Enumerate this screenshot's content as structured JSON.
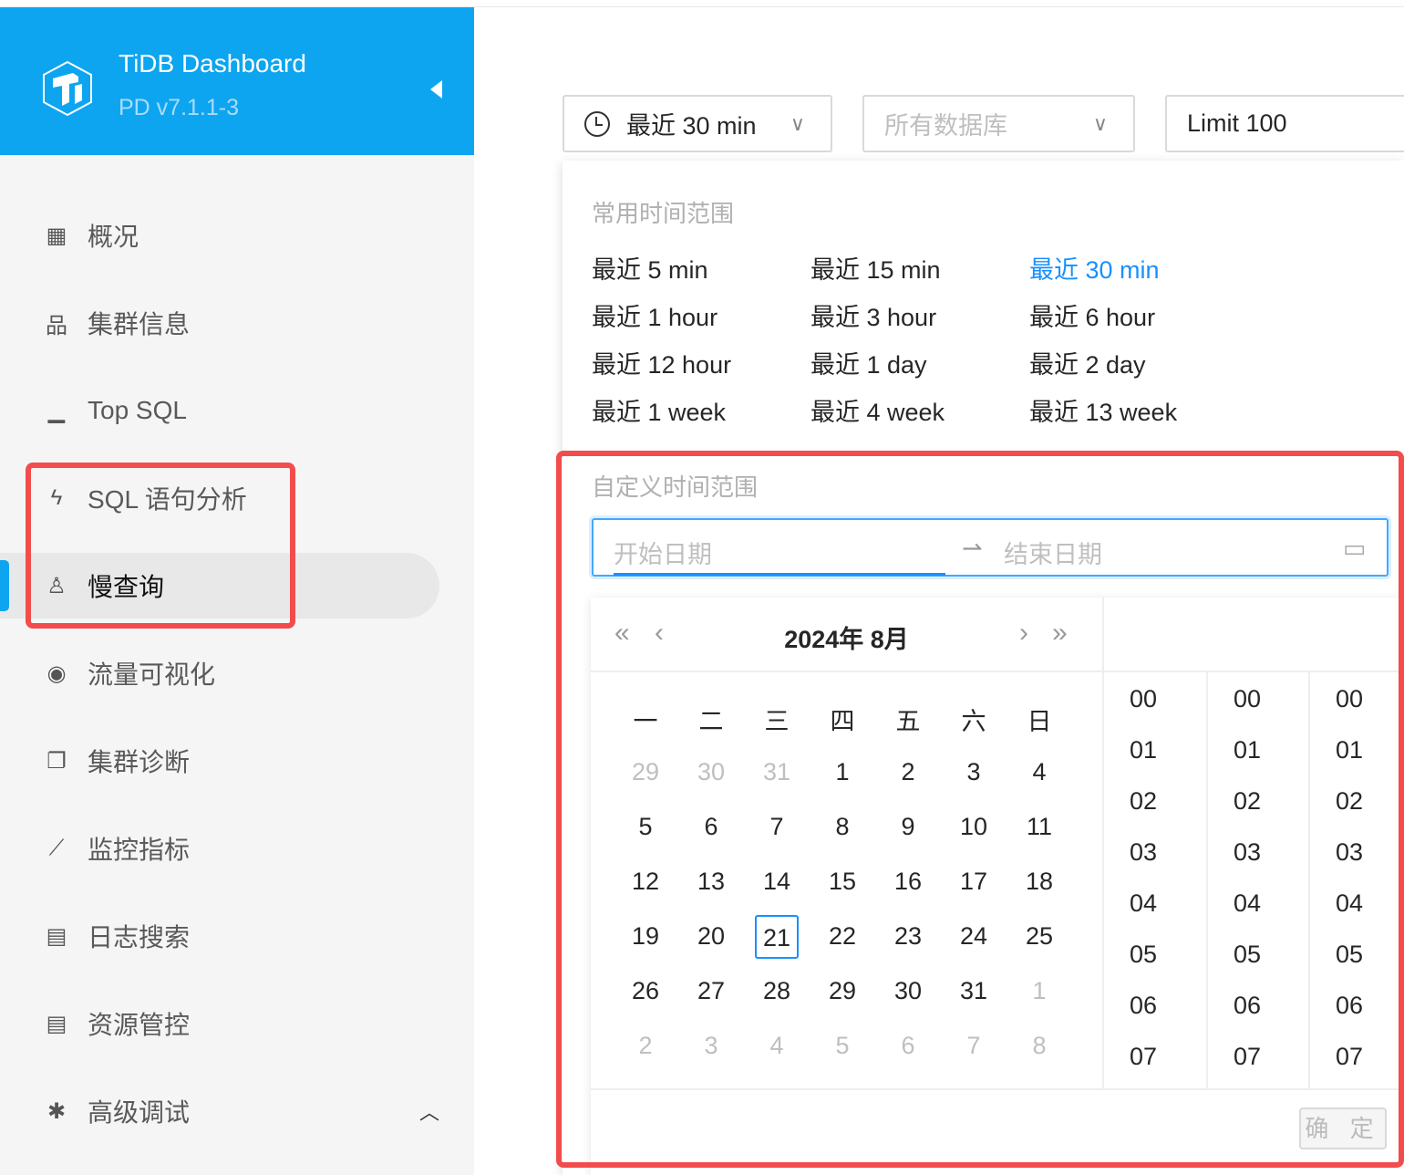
{
  "app": {
    "title": "TiDB Dashboard",
    "version": "PD v7.1.1-3"
  },
  "sidebar": {
    "items": [
      {
        "label": "概况",
        "icon": "dashboard-icon",
        "glyph": "▦"
      },
      {
        "label": "集群信息",
        "icon": "cluster-icon",
        "glyph": "品"
      },
      {
        "label": "Top SQL",
        "icon": "bar-chart-icon",
        "glyph": "▁"
      },
      {
        "label": "SQL 语句分析",
        "icon": "thunderbolt-icon",
        "glyph": "ϟ"
      },
      {
        "label": "慢查询",
        "icon": "alert-icon",
        "glyph": "♙"
      },
      {
        "label": "流量可视化",
        "icon": "eye-icon",
        "glyph": "◉"
      },
      {
        "label": "集群诊断",
        "icon": "diagnose-icon",
        "glyph": "❐"
      },
      {
        "label": "监控指标",
        "icon": "line-chart-icon",
        "glyph": "⟋"
      },
      {
        "label": "日志搜索",
        "icon": "file-search-icon",
        "glyph": "▤"
      },
      {
        "label": "资源管控",
        "icon": "resource-icon",
        "glyph": "▤"
      },
      {
        "label": "高级调试",
        "icon": "bug-icon",
        "glyph": "✱"
      }
    ],
    "selected": 4
  },
  "toolbar": {
    "time_range": "最近 30 min",
    "database_placeholder": "所有数据库",
    "limit": "Limit 100"
  },
  "picker": {
    "common_label": "常用时间范围",
    "presets": [
      "最近 5 min",
      "最近 15 min",
      "最近 30 min",
      "最近 1 hour",
      "最近 3 hour",
      "最近 6 hour",
      "最近 12 hour",
      "最近 1 day",
      "最近 2 day",
      "最近 1 week",
      "最近 4 week",
      "最近 13 week"
    ],
    "active_preset": 2,
    "custom_label": "自定义时间范围",
    "start_placeholder": "开始日期",
    "end_placeholder": "结束日期",
    "calendar_title": "2024年  8月",
    "weekdays": [
      "一",
      "二",
      "三",
      "四",
      "五",
      "六",
      "日"
    ],
    "days": [
      "29",
      "30",
      "31",
      "1",
      "2",
      "3",
      "4",
      "5",
      "6",
      "7",
      "8",
      "9",
      "10",
      "11",
      "12",
      "13",
      "14",
      "15",
      "16",
      "17",
      "18",
      "19",
      "20",
      "21",
      "22",
      "23",
      "24",
      "25",
      "26",
      "27",
      "28",
      "29",
      "30",
      "31",
      "1",
      "2",
      "3",
      "4",
      "5",
      "6",
      "7",
      "8"
    ],
    "first_current_index": 3,
    "last_current_index": 33,
    "today_index": 23,
    "hours": [
      "00",
      "01",
      "02",
      "03",
      "04",
      "05",
      "06",
      "07"
    ],
    "minutes": [
      "00",
      "01",
      "02",
      "03",
      "04",
      "05",
      "06",
      "07"
    ],
    "seconds": [
      "00",
      "01",
      "02",
      "03",
      "04",
      "05",
      "06",
      "07"
    ],
    "ok_label": "确 定"
  }
}
